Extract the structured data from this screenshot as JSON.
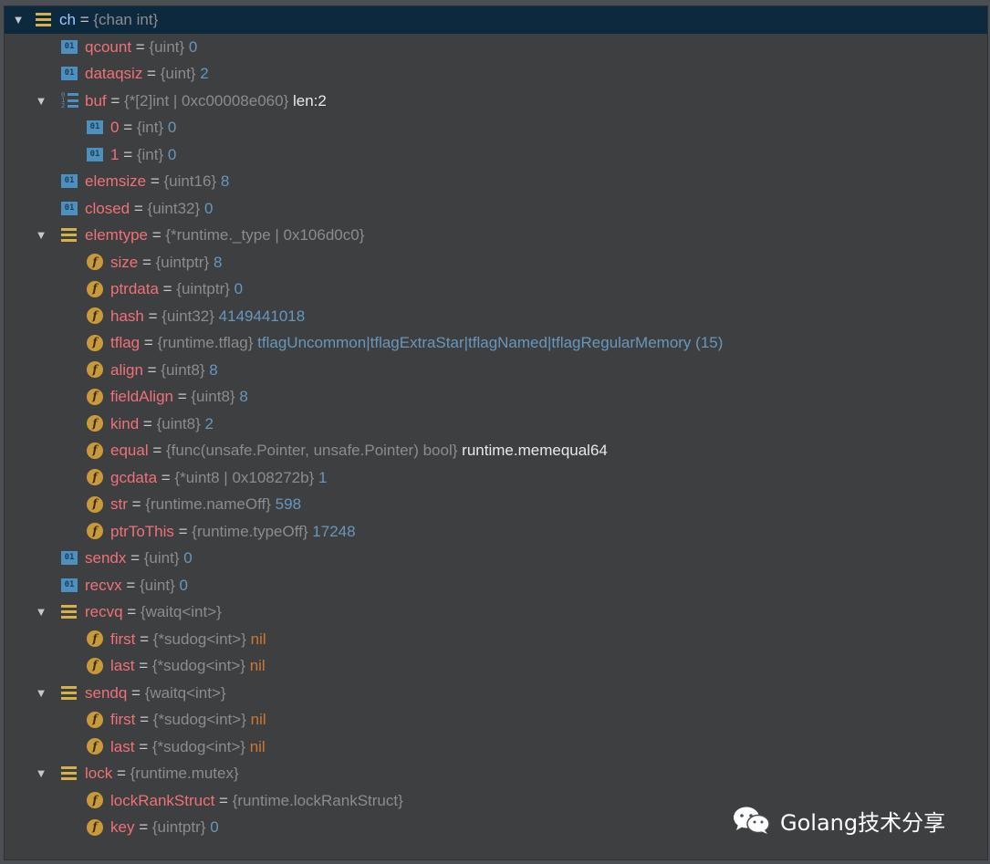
{
  "watermark": {
    "text": "Golang技术分享",
    "icon": "wechat-icon"
  },
  "colors": {
    "name": "#f07178",
    "number": "#6897bb",
    "nil": "#cc7832",
    "type": "#8a8d90",
    "selected_bg": "#0d293e"
  },
  "rows": [
    {
      "id": "ch",
      "depth": 0,
      "expanded": true,
      "icon": "struct",
      "name": "ch",
      "type": "{chan int}",
      "value": "",
      "value_kind": "",
      "selected": true
    },
    {
      "id": "qcount",
      "depth": 1,
      "icon": "prim",
      "name": "qcount",
      "type": "{uint}",
      "value": "0",
      "value_kind": "num"
    },
    {
      "id": "dataqsiz",
      "depth": 1,
      "icon": "prim",
      "name": "dataqsiz",
      "type": "{uint}",
      "value": "2",
      "value_kind": "num"
    },
    {
      "id": "buf",
      "depth": 1,
      "expanded": true,
      "icon": "array",
      "name": "buf",
      "type": "{*[2]int | 0xc00008e060}",
      "value": "len:2",
      "value_kind": "str"
    },
    {
      "id": "buf-0",
      "depth": 2,
      "icon": "prim",
      "name": "0",
      "type": "{int}",
      "value": "0",
      "value_kind": "num"
    },
    {
      "id": "buf-1",
      "depth": 2,
      "icon": "prim",
      "name": "1",
      "type": "{int}",
      "value": "0",
      "value_kind": "num"
    },
    {
      "id": "elemsize",
      "depth": 1,
      "icon": "prim",
      "name": "elemsize",
      "type": "{uint16}",
      "value": "8",
      "value_kind": "num"
    },
    {
      "id": "closed",
      "depth": 1,
      "icon": "prim",
      "name": "closed",
      "type": "{uint32}",
      "value": "0",
      "value_kind": "num"
    },
    {
      "id": "elemtype",
      "depth": 1,
      "expanded": true,
      "icon": "struct",
      "name": "elemtype",
      "type": "{*runtime._type | 0x106d0c0}",
      "value": "",
      "value_kind": ""
    },
    {
      "id": "size",
      "depth": 2,
      "icon": "field",
      "name": "size",
      "type": "{uintptr}",
      "value": "8",
      "value_kind": "num"
    },
    {
      "id": "ptrdata",
      "depth": 2,
      "icon": "field",
      "name": "ptrdata",
      "type": "{uintptr}",
      "value": "0",
      "value_kind": "num"
    },
    {
      "id": "hash",
      "depth": 2,
      "icon": "field",
      "name": "hash",
      "type": "{uint32}",
      "value": "4149441018",
      "value_kind": "num"
    },
    {
      "id": "tflag",
      "depth": 2,
      "icon": "field",
      "name": "tflag",
      "type": "{runtime.tflag}",
      "value": "tflagUncommon|tflagExtraStar|tflagNamed|tflagRegularMemory (15)",
      "value_kind": "num"
    },
    {
      "id": "align",
      "depth": 2,
      "icon": "field",
      "name": "align",
      "type": "{uint8}",
      "value": "8",
      "value_kind": "num"
    },
    {
      "id": "fieldAlign",
      "depth": 2,
      "icon": "field",
      "name": "fieldAlign",
      "type": "{uint8}",
      "value": "8",
      "value_kind": "num"
    },
    {
      "id": "kind",
      "depth": 2,
      "icon": "field",
      "name": "kind",
      "type": "{uint8}",
      "value": "2",
      "value_kind": "num"
    },
    {
      "id": "equal",
      "depth": 2,
      "icon": "field",
      "name": "equal",
      "type": "{func(unsafe.Pointer, unsafe.Pointer) bool}",
      "value": "runtime.memequal64",
      "value_kind": "str"
    },
    {
      "id": "gcdata",
      "depth": 2,
      "icon": "field",
      "name": "gcdata",
      "type": "{*uint8 | 0x108272b}",
      "value": "1",
      "value_kind": "num"
    },
    {
      "id": "str",
      "depth": 2,
      "icon": "field",
      "name": "str",
      "type": "{runtime.nameOff}",
      "value": "598",
      "value_kind": "num"
    },
    {
      "id": "ptrToThis",
      "depth": 2,
      "icon": "field",
      "name": "ptrToThis",
      "type": "{runtime.typeOff}",
      "value": "17248",
      "value_kind": "num"
    },
    {
      "id": "sendx",
      "depth": 1,
      "icon": "prim",
      "name": "sendx",
      "type": "{uint}",
      "value": "0",
      "value_kind": "num"
    },
    {
      "id": "recvx",
      "depth": 1,
      "icon": "prim",
      "name": "recvx",
      "type": "{uint}",
      "value": "0",
      "value_kind": "num"
    },
    {
      "id": "recvq",
      "depth": 1,
      "expanded": true,
      "icon": "struct",
      "name": "recvq",
      "type": "{waitq<int>}",
      "value": "",
      "value_kind": ""
    },
    {
      "id": "recvq-first",
      "depth": 2,
      "icon": "field",
      "name": "first",
      "type": "{*sudog<int>}",
      "value": "nil",
      "value_kind": "nil"
    },
    {
      "id": "recvq-last",
      "depth": 2,
      "icon": "field",
      "name": "last",
      "type": "{*sudog<int>}",
      "value": "nil",
      "value_kind": "nil"
    },
    {
      "id": "sendq",
      "depth": 1,
      "expanded": true,
      "icon": "struct",
      "name": "sendq",
      "type": "{waitq<int>}",
      "value": "",
      "value_kind": ""
    },
    {
      "id": "sendq-first",
      "depth": 2,
      "icon": "field",
      "name": "first",
      "type": "{*sudog<int>}",
      "value": "nil",
      "value_kind": "nil"
    },
    {
      "id": "sendq-last",
      "depth": 2,
      "icon": "field",
      "name": "last",
      "type": "{*sudog<int>}",
      "value": "nil",
      "value_kind": "nil"
    },
    {
      "id": "lock",
      "depth": 1,
      "expanded": true,
      "icon": "struct",
      "name": "lock",
      "type": "{runtime.mutex}",
      "value": "",
      "value_kind": ""
    },
    {
      "id": "lockRankStruct",
      "depth": 2,
      "icon": "field",
      "name": "lockRankStruct",
      "type": "{runtime.lockRankStruct}",
      "value": "",
      "value_kind": ""
    },
    {
      "id": "key",
      "depth": 2,
      "icon": "field",
      "name": "key",
      "type": "{uintptr}",
      "value": "0",
      "value_kind": "num"
    }
  ]
}
